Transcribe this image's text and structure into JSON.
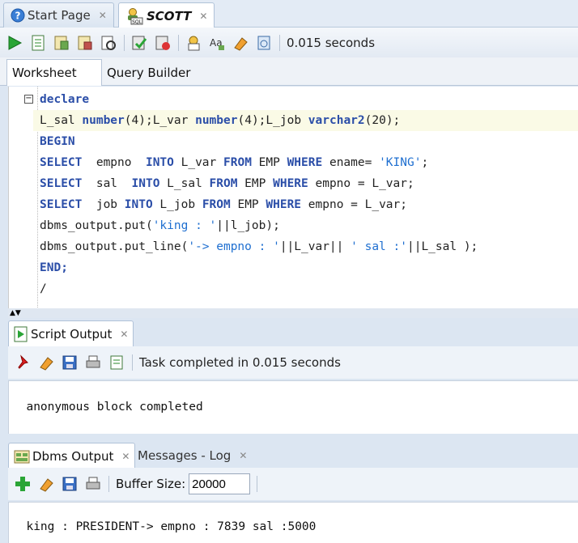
{
  "doc_tabs": [
    {
      "label": "Start Page",
      "icon": "help-icon"
    },
    {
      "label": "SCOTT",
      "icon": "sql-connection-icon",
      "active": true
    }
  ],
  "worksheet_toolbar": {
    "time_text": "0.015 seconds"
  },
  "worksheet_tabs": [
    "Worksheet",
    "Query Builder"
  ],
  "code": {
    "lines": [
      "declare",
      "L_sal number(4);L_var number(4);L_job varchar2(20);",
      "BEGIN",
      "SELECT  empno  INTO L_var FROM EMP WHERE ename= 'KING';",
      "SELECT  sal  INTO L_sal FROM EMP WHERE empno = L_var;",
      "SELECT  job INTO L_job FROM EMP WHERE empno = L_var;",
      "dbms_output.put('king : '||l_job);",
      "dbms_output.put_line('-> empno : '||L_var|| ' sal :'||L_sal );",
      "END;",
      "/"
    ]
  },
  "script_output": {
    "tab_label": "Script Output",
    "status_text": "Task completed in 0.015 seconds",
    "output_text": "anonymous block completed"
  },
  "dbms_output": {
    "tab_label": "Dbms Output",
    "messages_tab_label": "Messages - Log",
    "buffer_label": "Buffer Size:",
    "buffer_value": "20000",
    "output_text": "king : PRESIDENT-> empno : 7839 sal :5000"
  },
  "colors": {
    "keyword": "#2b4ea8",
    "string": "#1f6fd0",
    "highlight_line": "#fafae6"
  }
}
